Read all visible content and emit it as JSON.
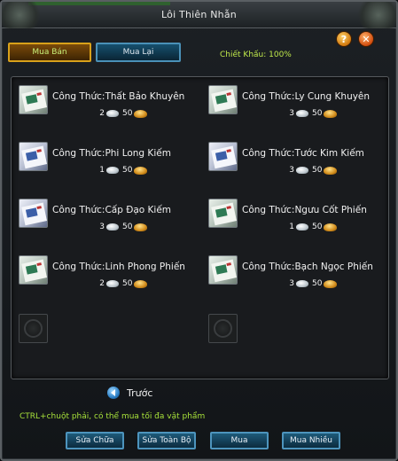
{
  "window": {
    "title": "Lôi Thiên Nhẫn"
  },
  "tabs": {
    "sell": "Mua Bán",
    "buyback": "Mua Lại"
  },
  "discount": "Chiết Khấu: 100%",
  "items": [
    {
      "name": "Công Thức:Thất Bảo Khuyên",
      "silver": "2",
      "gold": "50"
    },
    {
      "name": "Công Thức:Ly Cung Khuyên",
      "silver": "3",
      "gold": "50"
    },
    {
      "name": "Công Thức:Phi Long Kiếm",
      "silver": "1",
      "gold": "50"
    },
    {
      "name": "Công Thức:Tước Kim Kiếm",
      "silver": "3",
      "gold": "50"
    },
    {
      "name": "Công Thức:Cấp Đạo Kiếm",
      "silver": "3",
      "gold": "50"
    },
    {
      "name": "Công Thức:Ngưu Cốt Phiến",
      "silver": "1",
      "gold": "50"
    },
    {
      "name": "Công Thức:Linh Phong Phiến",
      "silver": "2",
      "gold": "50"
    },
    {
      "name": "Công Thức:Bạch Ngọc Phiến",
      "silver": "3",
      "gold": "50"
    }
  ],
  "nav": {
    "prev": "Trước"
  },
  "hint": "CTRL+chuột phải, có thể mua tối đa vật phẩm",
  "buttons": {
    "repair": "Sửa Chữa",
    "repair_all": "Sửa Toàn Bộ",
    "buy": "Mua",
    "buy_many": "Mua Nhiều"
  },
  "colors": {
    "accent_green": "#a8e23a",
    "tab_gold": "#d9a11a",
    "button_blue": "#4d94bd"
  },
  "icons": {
    "help": "question-icon",
    "close": "close-icon",
    "prev": "arrow-left-icon",
    "item": "recipe-scroll-icon"
  }
}
